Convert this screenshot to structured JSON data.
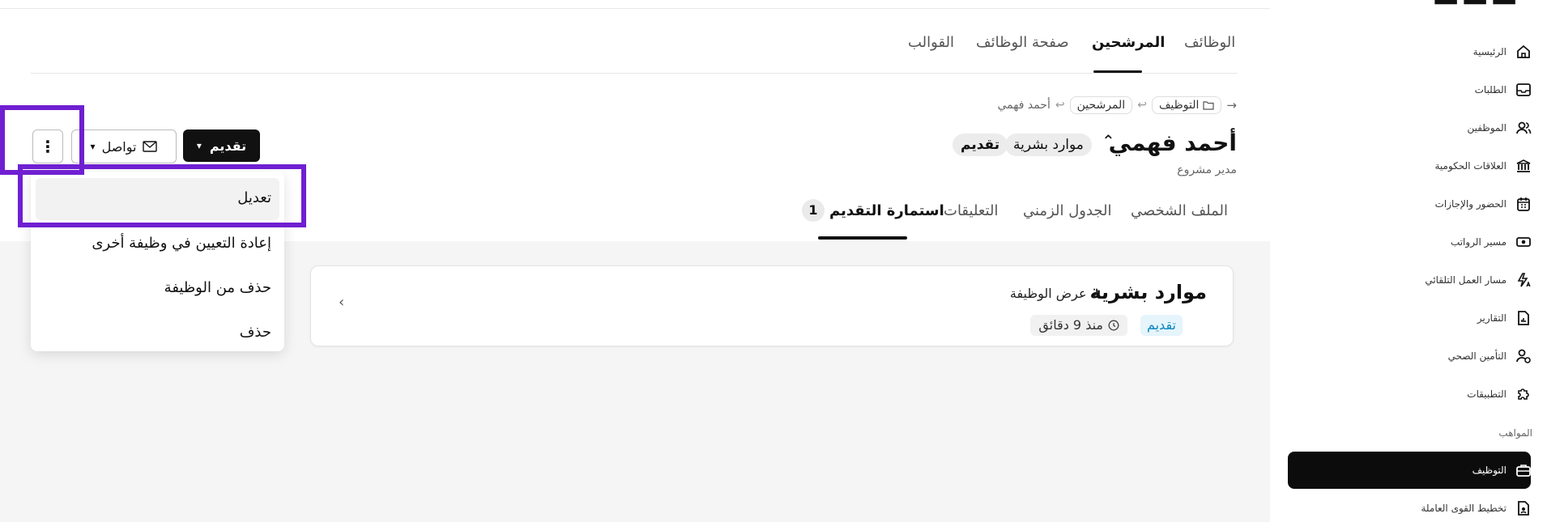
{
  "header_tabs": [
    {
      "label": "الوظائف",
      "active": false
    },
    {
      "label": "المرشحين",
      "active": true
    },
    {
      "label": "صفحة الوظائف",
      "active": false
    },
    {
      "label": "القوالب",
      "active": false
    }
  ],
  "breadcrumb": {
    "items": [
      "التوظيف",
      "المرشحين",
      "أحمد فهمي"
    ]
  },
  "candidate": {
    "name": "أحمد فهمي",
    "department_badge": "موارد بشرية",
    "stage_badge": "تقديم",
    "subtitle": "مدير مشروع"
  },
  "actions": {
    "stage_button": "تقديم",
    "contact_button": "تواصل",
    "more_label": "⋮"
  },
  "more_menu": {
    "items": [
      "تعديل",
      "إعادة التعيين في وظيفة أخرى",
      "حذف من الوظيفة",
      "حذف"
    ]
  },
  "sub_tabs": [
    {
      "label": "الملف الشخصي",
      "active": false
    },
    {
      "label": "الجدول الزمني",
      "active": false
    },
    {
      "label": "التعليقات",
      "active": false
    },
    {
      "label": "استمارة التقديم",
      "active": true,
      "count": "1"
    }
  ],
  "application_card": {
    "title": "موارد بشرية",
    "view_job_link": "عرض الوظيفة ↗",
    "stage_tag": "تقديم",
    "time_ago": "منذ 9 دقائق"
  },
  "sidebar": {
    "items": [
      {
        "label": "الرئيسية",
        "icon": "home-icon"
      },
      {
        "label": "الطلبات",
        "icon": "inbox-icon"
      },
      {
        "label": "الموظفين",
        "icon": "users-icon"
      },
      {
        "label": "العلاقات الحكومية",
        "icon": "bank-icon"
      },
      {
        "label": "الحضور والإجازات",
        "icon": "calendar-icon"
      },
      {
        "label": "مسير الرواتب",
        "icon": "cash-icon"
      },
      {
        "label": "مسار العمل التلقائي",
        "icon": "automation-icon"
      },
      {
        "label": "التقارير",
        "icon": "report-icon"
      },
      {
        "label": "التأمين الصحي",
        "icon": "health-icon"
      },
      {
        "label": "التطبيقات",
        "icon": "puzzle-icon"
      }
    ],
    "section_label": "المواهب",
    "talent_items": [
      {
        "label": "التوظيف",
        "icon": "briefcase-icon",
        "active": true
      },
      {
        "label": "تخطيط القوى العاملة",
        "icon": "plan-icon",
        "active": false
      }
    ]
  },
  "colors": {
    "highlight": "#6f1fd1",
    "primary": "#111111",
    "stage_tag_bg": "#e6f4fb",
    "stage_tag_text": "#0a87c2"
  }
}
